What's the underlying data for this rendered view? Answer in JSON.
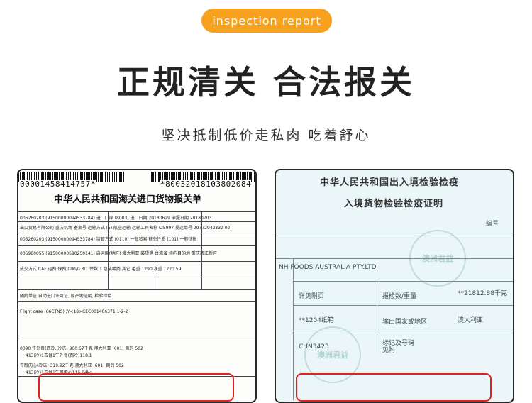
{
  "header": {
    "badge": "inspection report",
    "headline": "正规清关 合法报关",
    "subline": "坚决抵制低价走私肉 吃着舒心"
  },
  "left_doc": {
    "barcode_left": "00001458414757*",
    "barcode_right": "*80032018103802084",
    "title": "中华人民共和国海关进口货物报关单",
    "rows": [
      "005260203 (91500000094533784)  进口口岸 (8003)  进口日期 20180629  申报日期 20180703",
      "出口贸易有限公司  重庆机场  备案号  运输方式 (5) 航空运输  运输工具名称 CI5997  提运单号 29772943332 02",
      "005260203 (91500000094533784)  监管方式 (0110) 一般贸易  征免性质 (101) 一般征税",
      "005980055 (91500000590250141)  启运国(地区) 澳大利亚  装货港 台湾省  境内目的地 重庆西江新区",
      "成交方式 CAF  运费  保费 000/0.3/1  件数 1  包装种类 其它  毛重 1290  净重 1220.59",
      "随附单证  自动进口许可证, 原产地证明, 检验检疫"
    ],
    "marks": "Flight case (66CTNS) ;Y<18>CEC001406371:1-2-2",
    "items": [
      "0090 牛外脊(西冷, 冷冻)  900.67千克 澳大利亚  (601) 目的  502",
      "413(冷)1去骨1牛外脊(西冷)118.1",
      "牛眼肉心(冷冻)  319.92千克 澳大利亚  (601) 目的  502",
      "413(冷)1去骨1牛眼肉心116.84kg"
    ]
  },
  "right_doc": {
    "title_line1": "中华人民共和国出入境检验检疫",
    "title_line2": "入境货物检验检疫证明",
    "number_label": "编号",
    "consignor": "NH FOODS AUSTRALIA PTY.LTD",
    "goods_label": "详见附页",
    "quantity_label": "报检数/重量",
    "quantity_value": "**21812.88千克",
    "package_value": "**1204纸箱",
    "origin_label": "输出国家或地区",
    "origin_value": "澳大利亚",
    "marks_label": "标记及号码",
    "marks_value": "见附",
    "container_value": "CHN3423"
  },
  "watermark_text": "澳洲君益",
  "colors": {
    "accent": "#f7a21e",
    "highlight_box": "#e0231c"
  }
}
